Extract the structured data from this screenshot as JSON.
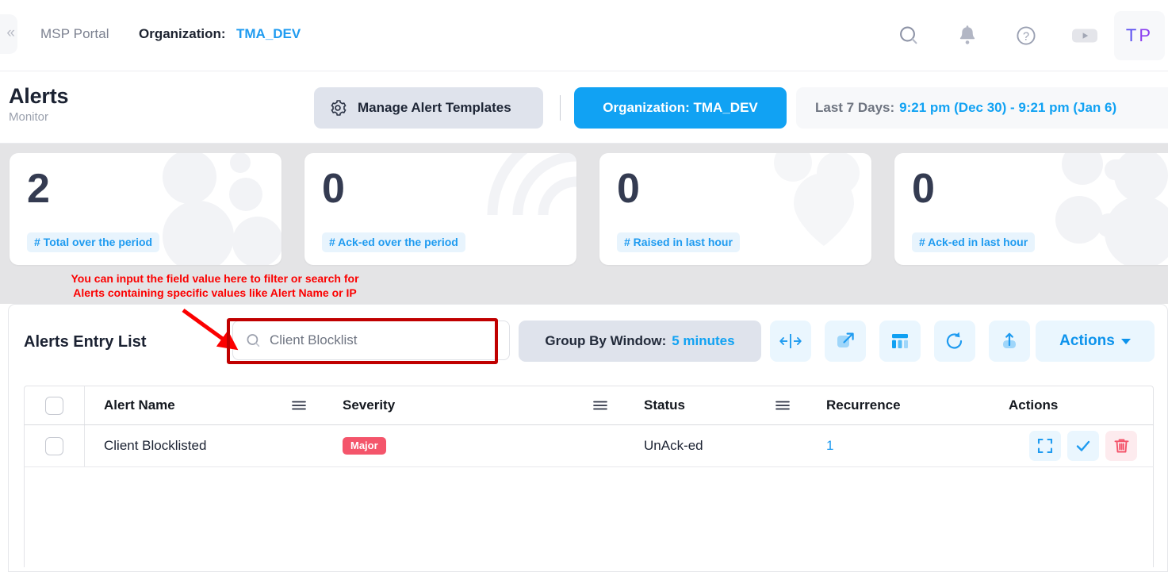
{
  "topbar": {
    "edge_glyph": "«",
    "msp_portal": "MSP Portal",
    "org_label": "Organization:",
    "org_value": "TMA_DEV",
    "icons": [
      {
        "name": "search-icon",
        "label": "Search"
      },
      {
        "name": "bell-icon",
        "label": "Notifications"
      },
      {
        "name": "help-icon",
        "label": "Help"
      },
      {
        "name": "play-video-icon",
        "label": "Videos"
      }
    ],
    "avatar_initial_1": "T",
    "avatar_initial_2": "P"
  },
  "page_header": {
    "title": "Alerts",
    "subtitle": "Monitor",
    "manage_templates_label": "Manage Alert Templates",
    "organization_button": "Organization: TMA_DEV",
    "range_label": "Last 7 Days:",
    "range_value": "9:21 pm (Dec 30) - 9:21 pm (Jan 6)"
  },
  "kpis": [
    {
      "value": "2",
      "label": "# Total over the period",
      "deco": "bubbles"
    },
    {
      "value": "0",
      "label": "# Ack-ed over the period",
      "deco": "arcs"
    },
    {
      "value": "0",
      "label": "# Raised in last hour",
      "deco": "pin"
    },
    {
      "value": "0",
      "label": "# Ack-ed in last hour",
      "deco": "molecule"
    }
  ],
  "annotation": {
    "line1": "You can input the field value here to filter or search for",
    "line2": "Alerts containing specific values like Alert Name or IP",
    "color": "#fb0000",
    "box_color": "#c00000"
  },
  "list_panel": {
    "title": "Alerts Entry List",
    "search_value": "Client Blocklist",
    "search_placeholder": "Client Blocklist",
    "group_by_label": "Group By Window:",
    "group_by_value": "5 minutes",
    "toolbar_buttons": [
      {
        "name": "fit-columns-button",
        "icon": "expand-horizontal-icon"
      },
      {
        "name": "open-external-button",
        "icon": "external-link-icon"
      },
      {
        "name": "columns-layout-button",
        "icon": "columns-icon"
      },
      {
        "name": "refresh-button",
        "icon": "refresh-icon"
      },
      {
        "name": "export-button",
        "icon": "upload-icon"
      }
    ],
    "actions_label": "Actions"
  },
  "table": {
    "columns": [
      "Alert Name",
      "Severity",
      "Status",
      "Recurrence",
      "Actions"
    ],
    "rows": [
      {
        "alert_name": "Client Blocklisted",
        "severity": "Major",
        "status": "UnAck-ed",
        "recurrence": "1"
      }
    ]
  },
  "colors": {
    "accent_blue": "#11a2f3",
    "link_blue": "#1f9bf0",
    "severity_major": "#f4556b",
    "annotation_red": "#fb0000",
    "page_bg": "#e4e4e6"
  }
}
